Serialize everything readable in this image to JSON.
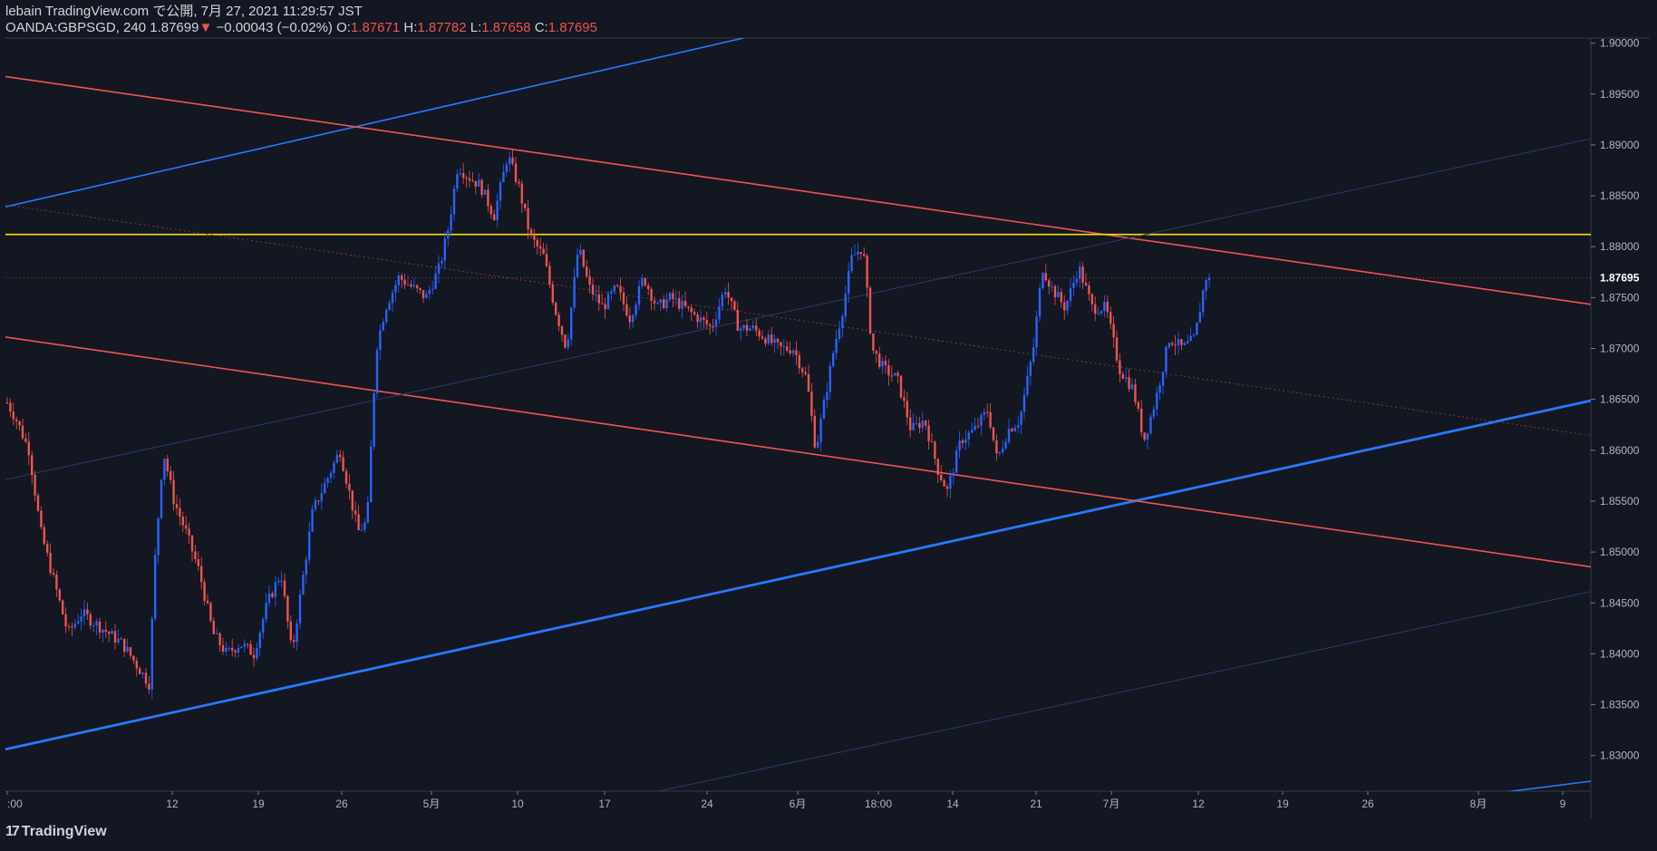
{
  "header": {
    "line1": "lebain TradingView.com で公開, 7月 27, 2021 11:29:57 JST",
    "symbol": "OANDA:GBPSGD, 240",
    "last": "1.87699",
    "change": "−0.00043 (−0.02%)",
    "o_label": "O:",
    "o_val": "1.87671",
    "h_label": "H:",
    "h_val": "1.87782",
    "l_label": "L:",
    "l_val": "1.87658",
    "c_label": "C:",
    "c_val": "1.87695"
  },
  "logo": {
    "text": "TradingView",
    "icon": "tradingview-logo-icon"
  },
  "colors": {
    "bg": "#131722",
    "up": "#2962ff",
    "down": "#ef5350",
    "blue_line": "#2979ff",
    "red_line": "#f05454",
    "yellow": "#f5e400",
    "axis": "#787b86"
  },
  "chart_data": {
    "type": "candlestick",
    "ylim": [
      1.8265,
      1.9005
    ],
    "y_ticks": [
      "1.90000",
      "1.89500",
      "1.89000",
      "1.88500",
      "1.88000",
      "1.87500",
      "1.87000",
      "1.86500",
      "1.86000",
      "1.85500",
      "1.85000",
      "1.84500",
      "1.84000",
      "1.83500",
      "1.83000"
    ],
    "x_ticks": [
      ":00",
      "12",
      "19",
      "26",
      "5月",
      "10",
      "17",
      "24",
      "6月",
      "18:00",
      "14",
      "21",
      "7月",
      "12",
      "19",
      "26",
      "8月",
      "9"
    ],
    "last_price_label": "1.87695",
    "close_path": [
      [
        0,
        1.866
      ],
      [
        18,
        1.863
      ],
      [
        32,
        1.86
      ],
      [
        45,
        1.852
      ],
      [
        60,
        1.847
      ],
      [
        75,
        1.842
      ],
      [
        90,
        1.844
      ],
      [
        105,
        1.843
      ],
      [
        120,
        1.842
      ],
      [
        135,
        1.841
      ],
      [
        150,
        1.839
      ],
      [
        165,
        1.837
      ],
      [
        170,
        1.848
      ],
      [
        180,
        1.86
      ],
      [
        192,
        1.855
      ],
      [
        205,
        1.852
      ],
      [
        220,
        1.848
      ],
      [
        235,
        1.842
      ],
      [
        250,
        1.84
      ],
      [
        265,
        1.841
      ],
      [
        280,
        1.84
      ],
      [
        295,
        1.845
      ],
      [
        310,
        1.848
      ],
      [
        322,
        1.84
      ],
      [
        335,
        1.848
      ],
      [
        345,
        1.854
      ],
      [
        355,
        1.856
      ],
      [
        365,
        1.858
      ],
      [
        375,
        1.86
      ],
      [
        385,
        1.856
      ],
      [
        395,
        1.852
      ],
      [
        405,
        1.853
      ],
      [
        415,
        1.87
      ],
      [
        425,
        1.874
      ],
      [
        440,
        1.877
      ],
      [
        455,
        1.876
      ],
      [
        470,
        1.875
      ],
      [
        485,
        1.878
      ],
      [
        495,
        1.882
      ],
      [
        505,
        1.888
      ],
      [
        515,
        1.887
      ],
      [
        530,
        1.886
      ],
      [
        545,
        1.883
      ],
      [
        560,
        1.889
      ],
      [
        572,
        1.886
      ],
      [
        585,
        1.881
      ],
      [
        600,
        1.879
      ],
      [
        612,
        1.874
      ],
      [
        625,
        1.87
      ],
      [
        638,
        1.88
      ],
      [
        650,
        1.876
      ],
      [
        665,
        1.874
      ],
      [
        680,
        1.876
      ],
      [
        695,
        1.873
      ],
      [
        710,
        1.877
      ],
      [
        725,
        1.874
      ],
      [
        740,
        1.875
      ],
      [
        755,
        1.874
      ],
      [
        770,
        1.873
      ],
      [
        785,
        1.872
      ],
      [
        800,
        1.876
      ],
      [
        815,
        1.872
      ],
      [
        830,
        1.872
      ],
      [
        845,
        1.871
      ],
      [
        860,
        1.87
      ],
      [
        875,
        1.87
      ],
      [
        890,
        1.867
      ],
      [
        900,
        1.86
      ],
      [
        910,
        1.865
      ],
      [
        920,
        1.87
      ],
      [
        930,
        1.874
      ],
      [
        940,
        1.879
      ],
      [
        952,
        1.88
      ],
      [
        962,
        1.87
      ],
      [
        975,
        1.868
      ],
      [
        990,
        1.867
      ],
      [
        1005,
        1.862
      ],
      [
        1020,
        1.863
      ],
      [
        1035,
        1.858
      ],
      [
        1045,
        1.856
      ],
      [
        1060,
        1.861
      ],
      [
        1075,
        1.862
      ],
      [
        1090,
        1.864
      ],
      [
        1100,
        1.859
      ],
      [
        1112,
        1.862
      ],
      [
        1125,
        1.863
      ],
      [
        1140,
        1.87
      ],
      [
        1150,
        1.878
      ],
      [
        1160,
        1.876
      ],
      [
        1175,
        1.874
      ],
      [
        1190,
        1.878
      ],
      [
        1205,
        1.874
      ],
      [
        1220,
        1.874
      ],
      [
        1235,
        1.868
      ],
      [
        1250,
        1.866
      ],
      [
        1262,
        1.861
      ],
      [
        1275,
        1.865
      ],
      [
        1290,
        1.871
      ],
      [
        1305,
        1.87
      ],
      [
        1318,
        1.871
      ],
      [
        1330,
        1.877
      ],
      [
        1335,
        1.87695
      ]
    ],
    "lines": [
      {
        "name": "blue-upper",
        "color": "#2979ff",
        "width": 1.6,
        "p1": [
          0,
          1.8838
        ],
        "p2": [
          820,
          1.9005
        ]
      },
      {
        "name": "blue-support",
        "color": "#2979ff",
        "width": 2.8,
        "p1": [
          0,
          1.8305
        ],
        "p2": [
          1828,
          1.8663
        ]
      },
      {
        "name": "blue-lower",
        "color": "#2979ff",
        "width": 1.6,
        "p1": [
          1650,
          1.8263
        ],
        "p2": [
          1828,
          1.8283
        ]
      },
      {
        "name": "red-resistance",
        "color": "#f05454",
        "width": 1.6,
        "p1": [
          0,
          1.8968
        ],
        "p2": [
          1828,
          1.8734
        ]
      },
      {
        "name": "red-lower",
        "color": "#f05454",
        "width": 1.6,
        "p1": [
          0,
          1.8712
        ],
        "p2": [
          1828,
          1.8476
        ]
      },
      {
        "name": "yellow-level",
        "color": "#f5e400",
        "width": 1.6,
        "p1": [
          0,
          1.8812
        ],
        "p2": [
          1828,
          1.8812
        ]
      },
      {
        "name": "red-dotted-mid",
        "color": "#7a3a3a",
        "width": 1,
        "dash": "2,3",
        "p1": [
          0,
          1.8842
        ],
        "p2": [
          1828,
          1.8605
        ]
      },
      {
        "name": "blue-faint-mid",
        "color": "#283a66",
        "width": 1,
        "p1": [
          0,
          1.857
        ],
        "p2": [
          1828,
          1.892
        ]
      },
      {
        "name": "blue-faint-low",
        "color": "#283a66",
        "width": 1,
        "p1": [
          700,
          1.826
        ],
        "p2": [
          1828,
          1.8475
        ]
      }
    ]
  }
}
